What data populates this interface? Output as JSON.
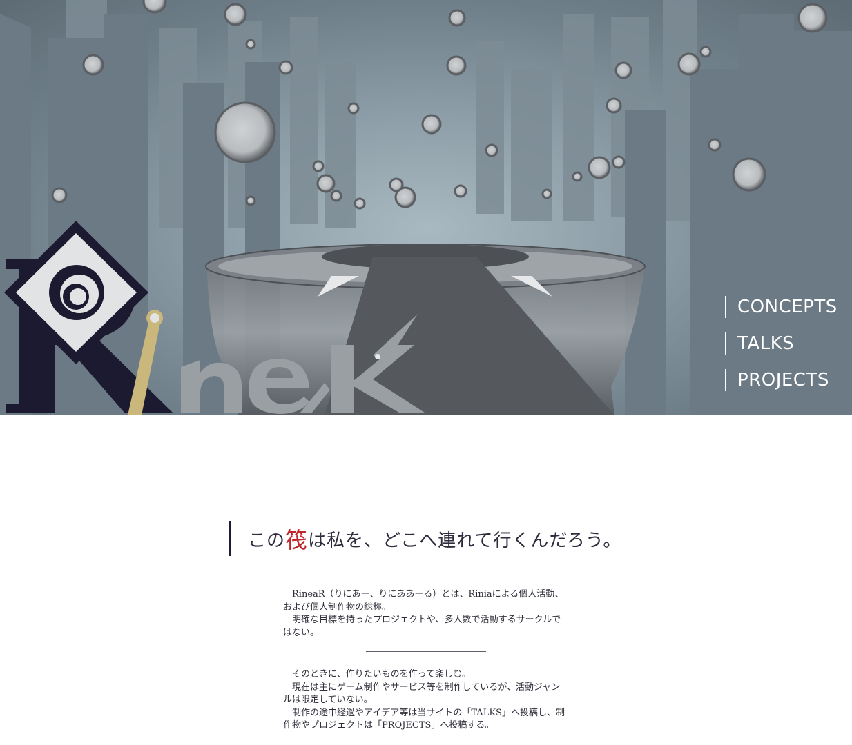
{
  "site": {
    "logo_text": "RineaR"
  },
  "nav": {
    "items": [
      {
        "label": "CONCEPTS"
      },
      {
        "label": "TALKS"
      },
      {
        "label": "PROJECTS"
      }
    ]
  },
  "main": {
    "headline_before": "この",
    "headline_accent": "筏",
    "headline_after": "は私を、どこへ連れて行くんだろう。",
    "intro": [
      "RineaR（りにあー、りにああーる）とは、Riniaによる個人活動、および個人制作物の総称。",
      "明確な目標を持ったプロジェクトや、多人数で活動するサークルではない。"
    ],
    "body": [
      "そのときに、作りたいものを作って楽しむ。",
      "現在は主にゲーム制作やサービス等を制作しているが、活動ジャンルは限定していない。",
      "制作の途中経過やアイデア等は当サイトの「TALKS」へ投稿し、制作物やプロジェクトは「PROJECTS」へ投稿する。"
    ]
  },
  "colors": {
    "accent": "#c0262b",
    "logo_navy": "#1c1a30",
    "logo_gold": "#c9b77c",
    "nav_text": "#ffffff"
  }
}
